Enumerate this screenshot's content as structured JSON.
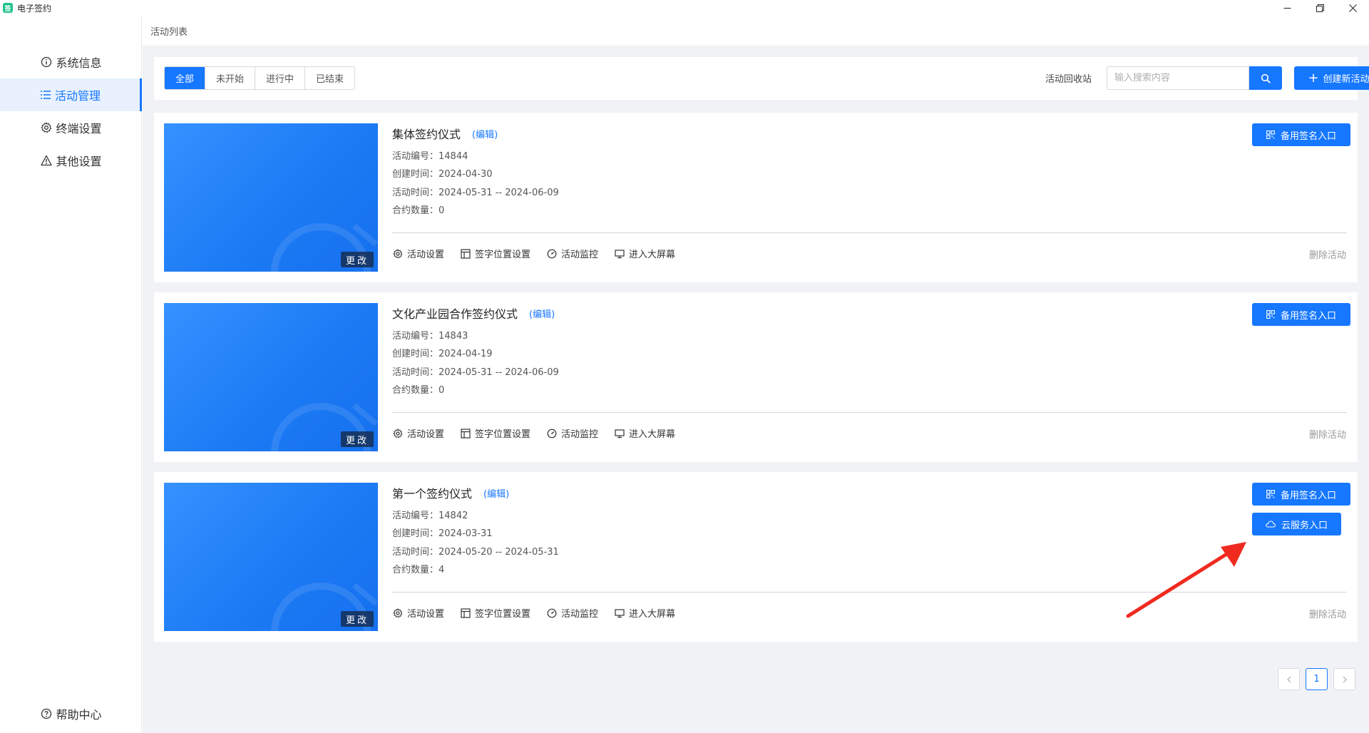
{
  "app": {
    "title": "电子签约",
    "icon_text": "签"
  },
  "window_controls": [
    "minimize-icon",
    "restore-icon",
    "close-icon"
  ],
  "sidebar": {
    "items": [
      {
        "label": "系统信息",
        "icon": "info-icon",
        "active": false
      },
      {
        "label": "活动管理",
        "icon": "list-icon",
        "active": true
      },
      {
        "label": "终端设置",
        "icon": "gear-icon",
        "active": false
      },
      {
        "label": "其他设置",
        "icon": "warning-icon",
        "active": false
      }
    ],
    "help": {
      "label": "帮助中心",
      "icon": "help-icon"
    }
  },
  "breadcrumb": "活动列表",
  "filters": {
    "tabs": [
      "全部",
      "未开始",
      "进行中",
      "已结束"
    ],
    "active_index": 0
  },
  "toolbar": {
    "recycle_label": "活动回收站",
    "search_placeholder": "输入搜索内容",
    "create_label": "创建新活动"
  },
  "card_labels": {
    "edit": "(编辑)",
    "change": "更改",
    "id_label": "活动编号：",
    "created_label": "创建时间：",
    "period_label": "活动时间：",
    "count_label": "合约数量：",
    "actions": {
      "settings": "活动设置",
      "sign_position": "签字位置设置",
      "monitor": "活动监控",
      "big_screen": "进入大屏幕"
    },
    "delete": "删除活动",
    "backup": "备用签名入口",
    "cloud": "云服务入口"
  },
  "activities": [
    {
      "title": "集体签约仪式",
      "id": "14844",
      "created": "2024-04-30",
      "period": "2024-05-31 -- 2024-06-09",
      "count": "0",
      "has_cloud": false
    },
    {
      "title": "文化产业园合作签约仪式",
      "id": "14843",
      "created": "2024-04-19",
      "period": "2024-05-31 -- 2024-06-09",
      "count": "0",
      "has_cloud": false
    },
    {
      "title": "第一个签约仪式",
      "id": "14842",
      "created": "2024-03-31",
      "period": "2024-05-20 -- 2024-05-31",
      "count": "4",
      "has_cloud": true
    }
  ],
  "pagination": {
    "prev": "<",
    "current": "1",
    "next": ">"
  },
  "colors": {
    "primary": "#1677ff",
    "annotation_arrow": "#f02a1f",
    "page_bg": "#f0f2f5"
  }
}
